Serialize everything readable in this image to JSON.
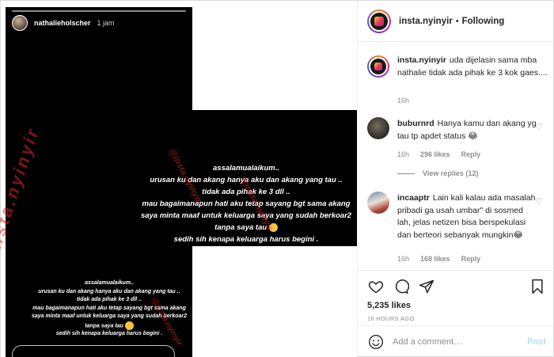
{
  "story": {
    "username": "nathalieholscher",
    "time": "1 jam",
    "lines": [
      "assalamualaikum..",
      "urusan ku dan akang hanya aku dan akang yang tau ..",
      "tidak ada pihak ke 3 dll ..",
      "mau bagaimanapun hati aku tetap sayang bgt sama akang",
      "saya minta maaf untuk keluarga saya yang sudah berkoar2 tanpa saya tau",
      "sedih sih kenapa keluarga harus begini ."
    ],
    "watermark": "@insta.nyinyir"
  },
  "header": {
    "username": "insta.nyinyir",
    "separator": "•",
    "follow_status": "Following"
  },
  "caption": {
    "username": "insta.nyinyir",
    "text": "uda dijelasin sama mba nathalie tidak ada pihak ke 3 kok gaes....",
    "time": "16h"
  },
  "comments": [
    {
      "username": "buburnrd",
      "text": "Hanya kamu dan akang yg tau tp apdet status 😂",
      "time": "16h",
      "likes": "296 likes",
      "reply": "Reply",
      "view_replies": "View replies (12)"
    },
    {
      "username": "incaaptr",
      "text": "Lain kali kalau ada masalah pribadi ga usah umbar\" di sosmed lah, jelas netizen bisa berspekulasi dan berteori sebanyak mungkin😂",
      "time": "16h",
      "likes": "168 likes",
      "reply": "Reply"
    }
  ],
  "actions": {
    "likes": "5,235 likes",
    "time_ago": "16 HOURS AGO"
  },
  "add_comment": {
    "placeholder": "Add a comment…",
    "post_label": "Post"
  },
  "colors": {
    "post_button": "#b2dffc",
    "watermark": "#dc2828",
    "muted": "#8e8e8e"
  }
}
